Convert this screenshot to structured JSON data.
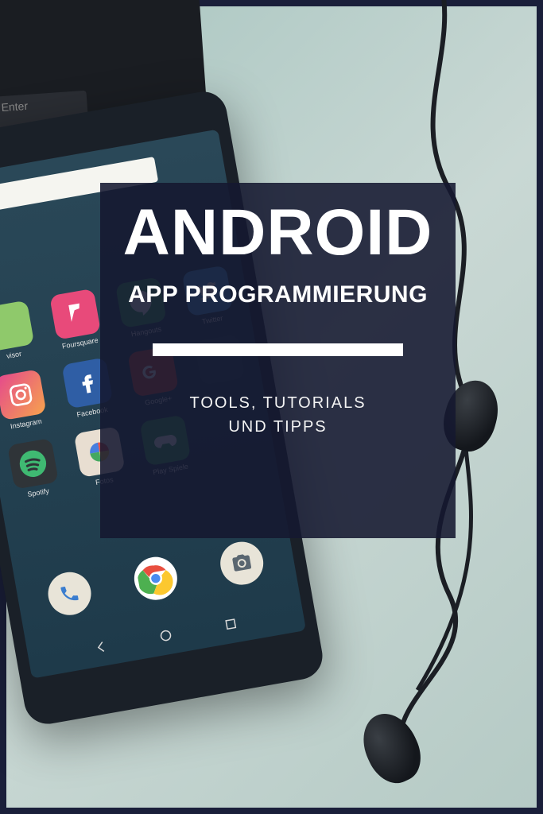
{
  "overlay": {
    "title": "ANDROID",
    "subtitle": "APP PROGRAMMIERUNG",
    "tagline_line1": "TOOLS, TUTORIALS",
    "tagline_line2": "UND TIPPS"
  },
  "keyboard": {
    "enter_label": "Enter"
  },
  "phone_apps": {
    "row1": [
      {
        "label": "visor",
        "bg": "#8fc96b"
      },
      {
        "label": "Foursquare",
        "bg": "#e84a7a"
      },
      {
        "label": "Hangouts",
        "bg": "#3fa35c"
      },
      {
        "label": "Twitter",
        "bg": "#4aa7e0"
      }
    ],
    "row2": [
      {
        "label": "Instagram",
        "bg": "linear-gradient(135deg,#e4478e,#f7a34d)"
      },
      {
        "label": "Facebook",
        "bg": "#2f5ea5"
      },
      {
        "label": "Google+",
        "bg": "#d64e3f"
      },
      {
        "label": "",
        "bg": "#2a4858"
      }
    ],
    "row3": [
      {
        "label": "Spotify",
        "bg": "#2f3438"
      },
      {
        "label": "Fotos",
        "bg": "#e8ded1"
      },
      {
        "label": "Play Spiele",
        "bg": "#3fa35c"
      },
      {
        "label": "",
        "bg": "transparent"
      }
    ]
  }
}
